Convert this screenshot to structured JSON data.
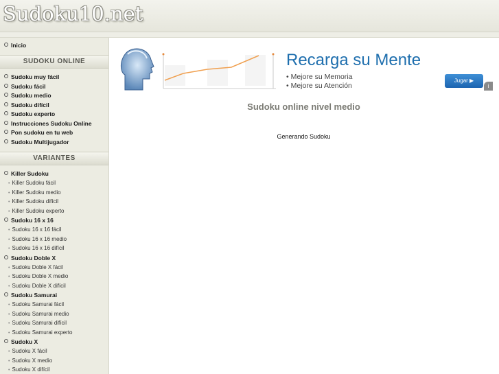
{
  "header": {
    "logo_text": "Sudoku10.net"
  },
  "sidebar": {
    "home_link": "Inicio",
    "section_online": "SUDOKU ONLINE",
    "online_links": [
      "Sudoku muy fácil",
      "Sudoku fácil",
      "Sudoku medio",
      "Sudoku difícil",
      "Sudoku experto",
      "Instrucciones Sudoku Online",
      "Pon sudoku en tu web",
      "Sudoku Multijugador"
    ],
    "section_variants": "VARIANTES",
    "variants": [
      {
        "label": "Killer Sudoku",
        "items": [
          "Killer Sudoku fácil",
          "Killer Sudoku medio",
          "Killer Sudoku difícil",
          "Killer Sudoku experto"
        ]
      },
      {
        "label": "Sudoku 16 x 16",
        "items": [
          "Sudoku 16 x 16 fácil",
          "Sudoku 16 x 16 medio",
          "Sudoku 16 x 16 difícil"
        ]
      },
      {
        "label": "Sudoku Doble X",
        "items": [
          "Sudoku Doble X fácil",
          "Sudoku Doble X medio",
          "Sudoku Doble X difícil"
        ]
      },
      {
        "label": "Sudoku Samurai",
        "items": [
          "Sudoku Samurai fácil",
          "Sudoku Samurai medio",
          "Sudoku Samurai difícil",
          "Sudoku Samurai experto"
        ]
      },
      {
        "label": "Sudoku X",
        "items": [
          "Sudoku X fácil",
          "Sudoku X medio",
          "Sudoku X difícil"
        ]
      }
    ]
  },
  "ad": {
    "title": "Recarga su Mente",
    "line1": "• Mejore su Memoria",
    "line2": "• Mejore su Atención",
    "button_label": "Jugar ▶",
    "accent_color": "#1f6fae"
  },
  "main": {
    "title": "Sudoku online nivel medio",
    "status": "Generando Sudoku"
  }
}
